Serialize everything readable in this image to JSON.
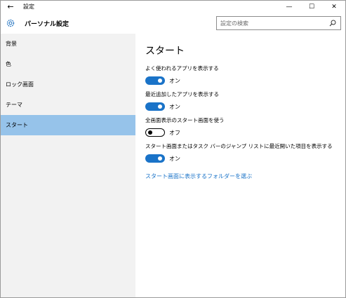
{
  "titlebar": {
    "back_glyph": "←",
    "title": "設定",
    "minimize_glyph": "—",
    "maximize_glyph": "☐",
    "close_glyph": "✕"
  },
  "header": {
    "title": "パーソナル設定",
    "search_placeholder": "設定の検索"
  },
  "sidebar": {
    "items": [
      {
        "label": "背景",
        "active": false
      },
      {
        "label": "色",
        "active": false
      },
      {
        "label": "ロック画面",
        "active": false
      },
      {
        "label": "テーマ",
        "active": false
      },
      {
        "label": "スタート",
        "active": true
      }
    ]
  },
  "content": {
    "title": "スタート",
    "settings": [
      {
        "label": "よく使われるアプリを表示する",
        "state": "オン",
        "on": true
      },
      {
        "label": "最近追加したアプリを表示する",
        "state": "オン",
        "on": true
      },
      {
        "label": "全画面表示のスタート画面を使う",
        "state": "オフ",
        "on": false
      },
      {
        "label": "スタート画面またはタスク バーのジャンプ リストに最近開いた項目を表示する",
        "state": "オン",
        "on": true
      }
    ],
    "link": "スタート画面に表示するフォルダーを選ぶ"
  },
  "colors": {
    "accent": "#1a73c8",
    "sidebar_bg": "#f2f2f2",
    "selected_bg": "#96c3ea"
  }
}
